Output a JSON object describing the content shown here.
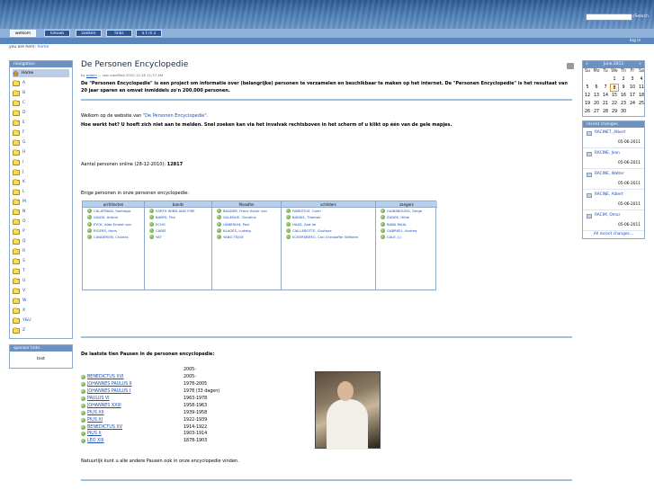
{
  "header": {
    "search_placeholder": "",
    "search_button": "Search"
  },
  "tabs": [
    "welkom",
    "nieuws",
    "zoeken",
    "links",
    "a t m z"
  ],
  "login": "log in",
  "breadcrumb": {
    "prefix": "you are here:",
    "home": "home"
  },
  "navigation": {
    "title": "navigation",
    "home": "Home",
    "items": [
      "A",
      "B",
      "C",
      "D",
      "E",
      "F",
      "G",
      "H",
      "I",
      "J",
      "K",
      "L",
      "M",
      "N",
      "O",
      "P",
      "Q",
      "R",
      "S",
      "T",
      "U",
      "V",
      "W",
      "X",
      "Y&U",
      "Z"
    ]
  },
  "sponsor": {
    "title": "sponsor links",
    "text": "test"
  },
  "main": {
    "title": "De Personen Encyclopedie",
    "byline_by": "by",
    "byline_author": "admin",
    "byline_rest": "— last modified 2010-12-28 11:37 AM",
    "intro": "De \"Personen Encyclopedie\" is een project om informatie over (belangrijke) personen te verzamelen en beschikbaar te maken op het internet. De \"Personen Encyclopedie\" is het resultaat van 20 jaar sparen en omvat inmiddels zo'n 200.000 personen.",
    "welcome_prefix": "Welkom op de website van ",
    "welcome_link": "\"De Personen Encyclopedie\"",
    "welcome_suffix": ".",
    "howto": "Hoe werkt het? U hoeft zich niet aan te melden. Snel zoeken kan via het invalvak rechtsboven in het scherm of u klikt op één van de gele mapjes.",
    "count_label": "Aantal personen online (28-12-2010):",
    "count_value": "12817",
    "enige": "Enige personen in onze personen encyclopedie:",
    "popes_title": "De laatste tien Pausen in de personen encyclopedie:",
    "natuurlijk": "Natuurlijk kunt u alle andere Pausen ook in onze encyclopedie vinden."
  },
  "people_table": {
    "columns": [
      {
        "header": "architecten",
        "items": [
          "CALATRAVA, Santiago",
          "GAUDI, Antoni",
          "EYCK, Aldo Ernest van",
          "EIGERS, Hans",
          "CANDERON, Charles"
        ]
      },
      {
        "header": "bands",
        "items": [
          "EARTH WIND AND FIRE",
          "BABYS, The",
          "ECHO",
          "CABIS",
          "YAT"
        ]
      },
      {
        "header": "filosofen",
        "items": [
          "BAADER, Franz Xaver von",
          "GALENUS, Claudius",
          "HÄBERLIN, Paul",
          "KLAGES, Ludwig",
          "YANG TSJOE"
        ]
      },
      {
        "header": "schilders",
        "items": [
          "FABRITIUS, Carel",
          "BAKKIS, Thomas",
          "HAAS, Aad de",
          "CAILLEBOTTE, Gustave",
          "ECKERSBERG, Carl Christoffer Wilhelm"
        ]
      },
      {
        "header": "zangers",
        "items": [
          "GAINSBOURG, Serge",
          "ZADEK, Hilde",
          "BABA MAAL",
          "GABRIELI, Andrea",
          "CALE, J.J."
        ]
      }
    ]
  },
  "popes": [
    {
      "name": "",
      "years": "2005-"
    },
    {
      "name": "BENEDICTUS XVI",
      "years": "2005-"
    },
    {
      "name": "JOHANNES PAULUS II",
      "years": "1978-2005"
    },
    {
      "name": "JOHANNES PAULUS I",
      "years": "1978 (33 dagen)"
    },
    {
      "name": "PAULUS VI",
      "years": "1963-1978"
    },
    {
      "name": "JOHANNES XXIII",
      "years": "1958-1963"
    },
    {
      "name": "PIUS XII",
      "years": "1939-1958"
    },
    {
      "name": "PIUS XI",
      "years": "1922-1939"
    },
    {
      "name": "BENEDICTUS XV",
      "years": "1914-1922"
    },
    {
      "name": "PIUS X",
      "years": "1903-1914"
    },
    {
      "name": "LEO XIII",
      "years": "1878-1903"
    }
  ],
  "calendar": {
    "month": "June 2011",
    "prev": "«",
    "next": "»",
    "dow": [
      "Su",
      "Mo",
      "Tu",
      "We",
      "Th",
      "Fr",
      "Sa"
    ],
    "days": [
      "",
      "",
      "",
      "1",
      "2",
      "3",
      "4",
      "5",
      "6",
      "7",
      "8",
      "9",
      "10",
      "11",
      "12",
      "13",
      "14",
      "15",
      "16",
      "17",
      "18",
      "19",
      "20",
      "21",
      "22",
      "23",
      "24",
      "25",
      "26",
      "27",
      "28",
      "29",
      "30",
      "",
      ""
    ],
    "today": "8"
  },
  "recent_changes": {
    "title": "recent changes",
    "items": [
      {
        "name": "RACINET, Albert",
        "date": "05-06-2011"
      },
      {
        "name": "RACINE, Jean",
        "date": "05-06-2011"
      },
      {
        "name": "RACINE, Walter",
        "date": "05-06-2011"
      },
      {
        "name": "RACINE, Albert",
        "date": "05-06-2011"
      },
      {
        "name": "RACIM, Omar",
        "date": "05-06-2011"
      }
    ],
    "all": "All recent changes…"
  },
  "colors": {
    "header": "#2d5a93",
    "tab": "#2a5696",
    "portlet": "#6d92c2",
    "link": "#1a4fb8"
  }
}
